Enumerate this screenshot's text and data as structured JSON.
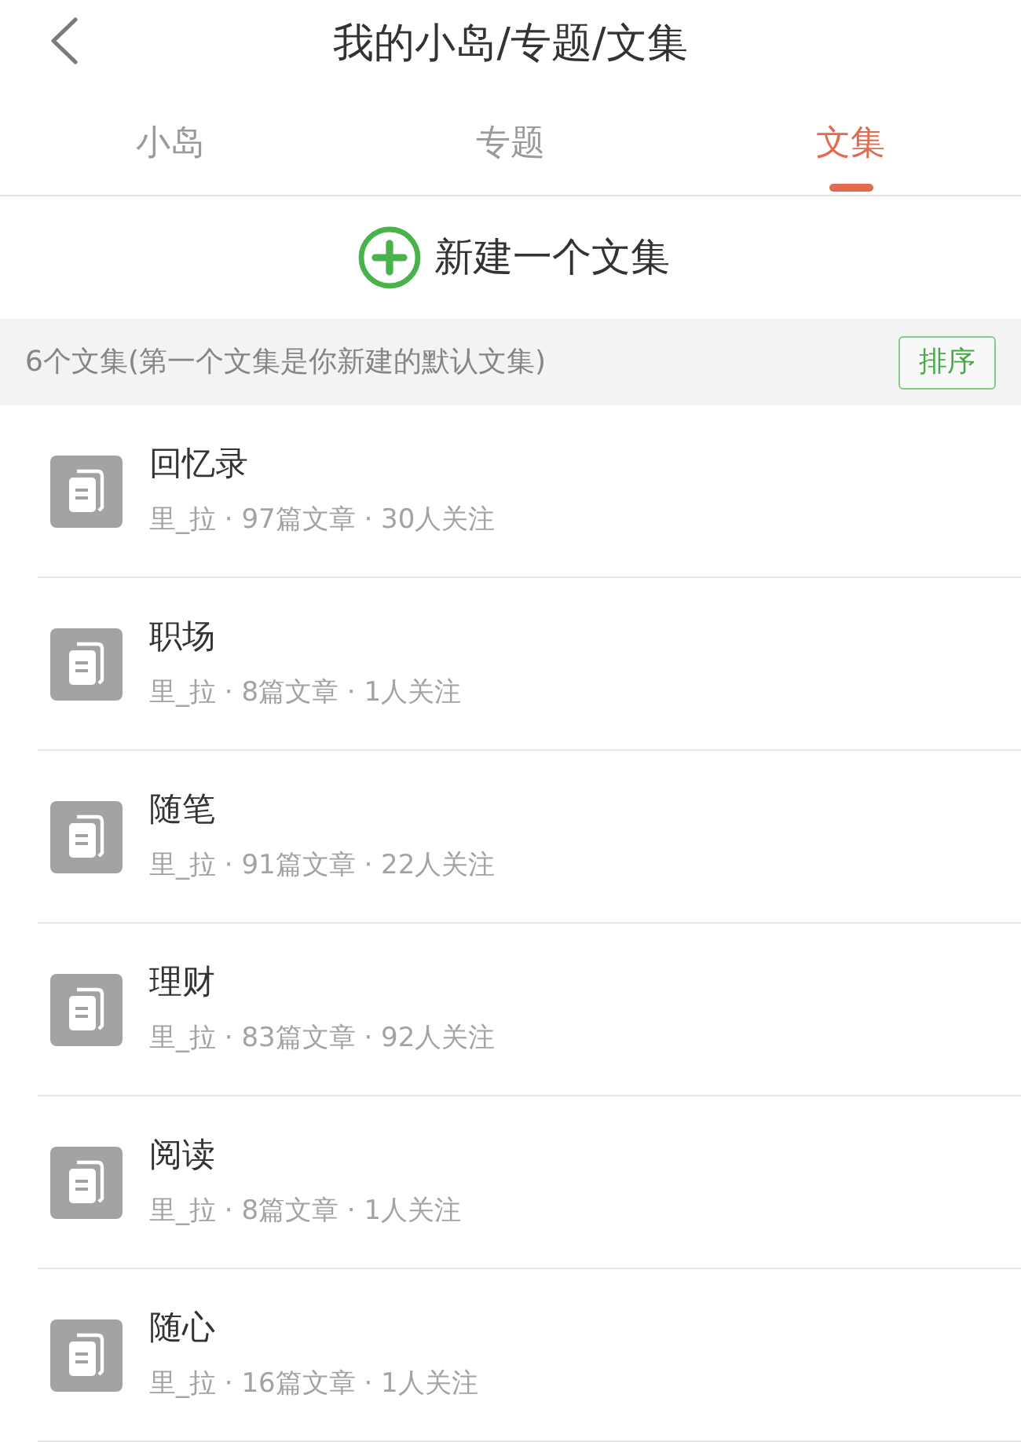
{
  "header": {
    "title": "我的小岛/专题/文集"
  },
  "tabs": [
    {
      "label": "小岛",
      "selected": false
    },
    {
      "label": "专题",
      "selected": false
    },
    {
      "label": "文集",
      "selected": true
    }
  ],
  "new_collection": {
    "label": "新建一个文集"
  },
  "summary_bar": {
    "text": "6个文集(第一个文集是你新建的默认文集)",
    "sort_button": "排序"
  },
  "collections": [
    {
      "name": "回忆录",
      "meta": "里_拉 · 97篇文章 · 30人关注"
    },
    {
      "name": "职场",
      "meta": "里_拉 · 8篇文章 · 1人关注"
    },
    {
      "name": "随笔",
      "meta": "里_拉 · 91篇文章 · 22人关注"
    },
    {
      "name": "理财",
      "meta": "里_拉 · 83篇文章 · 92人关注"
    },
    {
      "name": "阅读",
      "meta": "里_拉 · 8篇文章 · 1人关注"
    },
    {
      "name": "随心",
      "meta": "里_拉 · 16篇文章 · 1人关注"
    }
  ]
}
